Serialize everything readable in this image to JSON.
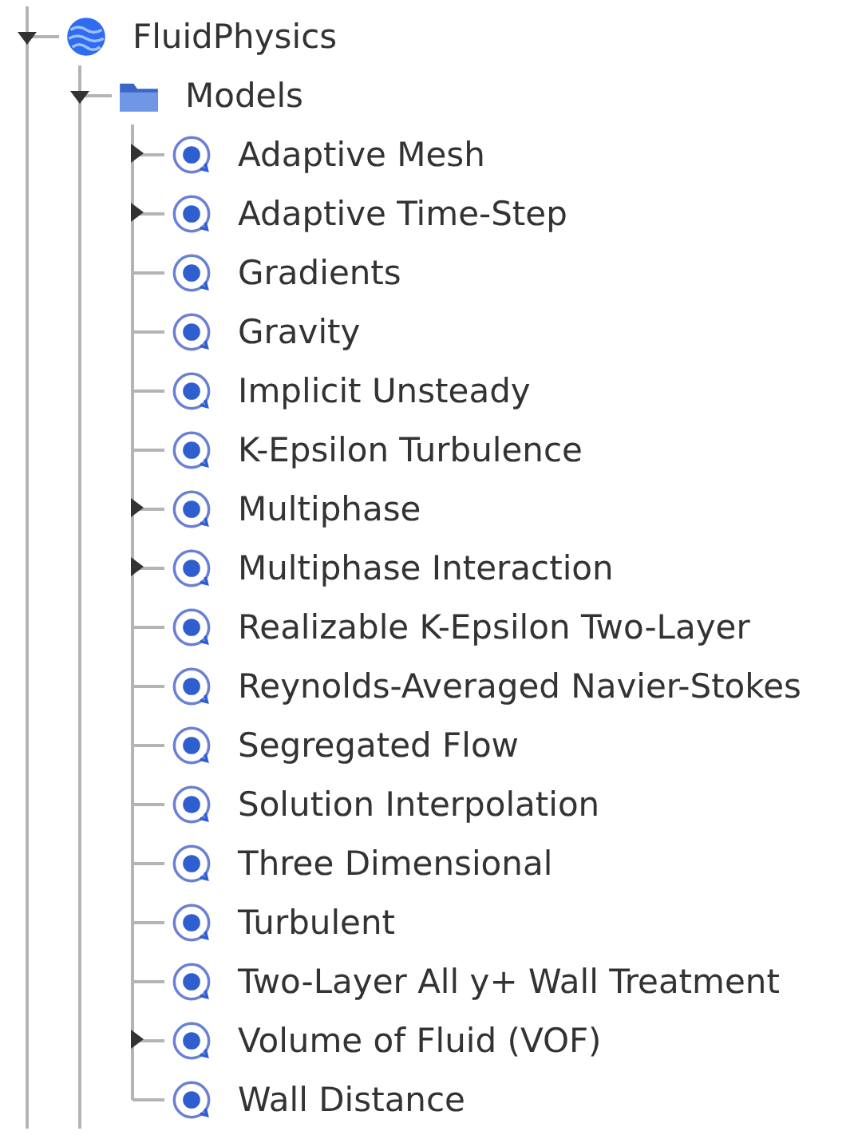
{
  "tree": [
    {
      "label": "FluidPhysics",
      "kind": "physics",
      "expanded": true,
      "children": [
        {
          "label": "Models",
          "kind": "folder",
          "expanded": true,
          "children": [
            {
              "label": "Adaptive Mesh",
              "kind": "model",
              "expanded": false
            },
            {
              "label": "Adaptive Time-Step",
              "kind": "model",
              "expanded": false
            },
            {
              "label": "Gradients",
              "kind": "model"
            },
            {
              "label": "Gravity",
              "kind": "model"
            },
            {
              "label": "Implicit Unsteady",
              "kind": "model"
            },
            {
              "label": "K-Epsilon Turbulence",
              "kind": "model"
            },
            {
              "label": "Multiphase",
              "kind": "model",
              "expanded": false
            },
            {
              "label": "Multiphase Interaction",
              "kind": "model",
              "expanded": false
            },
            {
              "label": "Realizable K-Epsilon Two-Layer",
              "kind": "model"
            },
            {
              "label": "Reynolds-Averaged Navier-Stokes",
              "kind": "model"
            },
            {
              "label": "Segregated Flow",
              "kind": "model"
            },
            {
              "label": "Solution Interpolation",
              "kind": "model"
            },
            {
              "label": "Three Dimensional",
              "kind": "model"
            },
            {
              "label": "Turbulent",
              "kind": "model"
            },
            {
              "label": "Two-Layer All y+ Wall Treatment",
              "kind": "model"
            },
            {
              "label": "Volume of Fluid (VOF)",
              "kind": "model",
              "expanded": false
            },
            {
              "label": "Wall Distance",
              "kind": "model"
            }
          ]
        }
      ]
    }
  ]
}
